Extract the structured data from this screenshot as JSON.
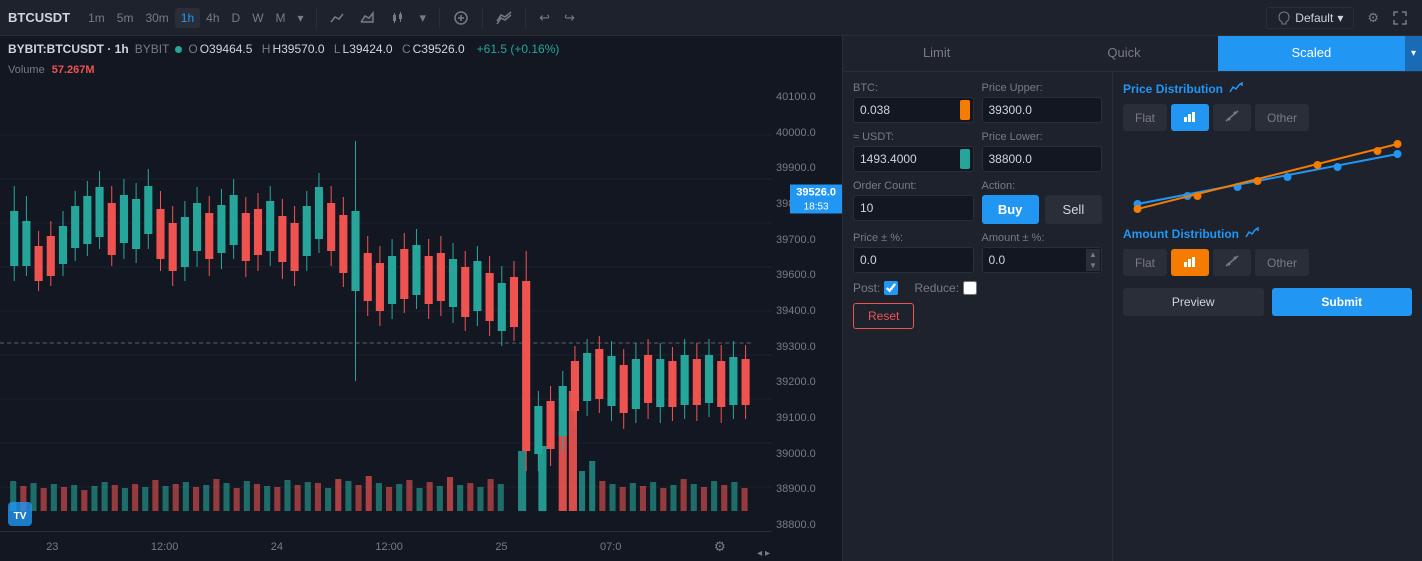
{
  "toolbar": {
    "symbol": "BTCUSDT",
    "intervals": [
      "1m",
      "5m",
      "30m",
      "1h",
      "4h",
      "D",
      "W",
      "M"
    ],
    "active_interval": "1h",
    "default_label": "Default",
    "icons": {
      "line": "📈",
      "candle": "📊",
      "bar": "⬛",
      "plus": "+",
      "indicator": "ƒ",
      "wave": "∿",
      "undo": "↩",
      "redo": "↪",
      "cloud": "☁",
      "settings": "⚙",
      "fullscreen": "⛶"
    }
  },
  "chart_info": {
    "symbol": "BYBIT:BTCUSDT",
    "interval": "1h",
    "exchange": "BYBIT",
    "open": "O39464.5",
    "high": "H39570.0",
    "low": "L39424.0",
    "close": "C39526.0",
    "change": "+61.5 (+0.16%)",
    "volume_label": "Volume",
    "volume_val": "57.267M"
  },
  "price_levels": [
    "40100.0",
    "40000.0",
    "39900.0",
    "39800.0",
    "39700.0",
    "39600.0",
    "39400.0",
    "39300.0",
    "39200.0",
    "39100.0",
    "39000.0",
    "38900.0",
    "38800.0"
  ],
  "current_price": {
    "price": "39526.0",
    "time": "18:53"
  },
  "time_labels": [
    "23",
    "12:00",
    "24",
    "12:00",
    "25",
    "07:0"
  ],
  "order_panel": {
    "tabs": [
      {
        "id": "limit",
        "label": "Limit"
      },
      {
        "id": "quick",
        "label": "Quick"
      },
      {
        "id": "scaled",
        "label": "Scaled",
        "active": true
      }
    ],
    "btc_label": "BTC:",
    "btc_value": "0.038",
    "price_upper_label": "Price Upper:",
    "price_upper_value": "39300.0",
    "usdt_label": "≈ USDT:",
    "usdt_value": "1493.4000",
    "price_lower_label": "Price Lower:",
    "price_lower_value": "38800.0",
    "order_count_label": "Order Count:",
    "order_count_value": "10",
    "action_label": "Action:",
    "buy_label": "Buy",
    "sell_label": "Sell",
    "price_pct_label": "Price ± %:",
    "price_pct_value": "0.0",
    "amount_pct_label": "Amount ± %:",
    "amount_pct_value": "0.0",
    "post_label": "Post:",
    "reduce_label": "Reduce:",
    "reset_label": "Reset"
  },
  "distribution": {
    "price_header": "Price Distribution",
    "price_chart_icon": "📈",
    "flat_label": "Flat",
    "bar_icon_label": "▦",
    "line_icon_label": "⟋",
    "other_label": "Other",
    "amount_header": "Amount Distribution",
    "amount_chart_icon": "📈",
    "preview_label": "Preview",
    "submit_label": "Submit"
  }
}
